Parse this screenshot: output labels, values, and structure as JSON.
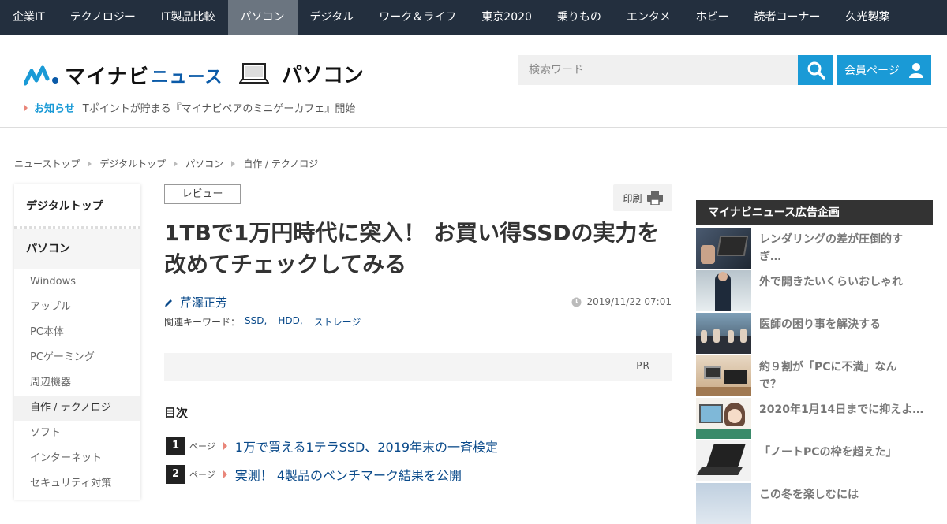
{
  "nav": {
    "items": [
      "企業IT",
      "テクノロジー",
      "IT製品比較",
      "パソコン",
      "デジタル",
      "ワーク＆ライフ",
      "東京2020",
      "乗りもの",
      "エンタメ",
      "ホビー",
      "読者コーナー",
      "久光製薬"
    ],
    "active_index": 3
  },
  "header": {
    "logo_main": "マイナビ",
    "logo_sub": "ニュース",
    "section_title": "パソコン",
    "search_placeholder": "検索ワード",
    "member_label": "会員ページ",
    "notice_label": "お知らせ",
    "notice_text": "Tポイントが貯まる『マイナビペアのミニゲーカフェ』開始"
  },
  "breadcrumb": [
    "ニューストップ",
    "デジタルトップ",
    "パソコン",
    "自作 / テクノロジ"
  ],
  "sidebar": {
    "head": "デジタルトップ",
    "section": "パソコン",
    "items": [
      "Windows",
      "アップル",
      "PC本体",
      "PCゲーミング",
      "周辺機器",
      "自作 / テクノロジ",
      "ソフト",
      "インターネット",
      "セキュリティ対策"
    ],
    "active_index": 5
  },
  "article": {
    "tag": "レビュー",
    "print_label": "印刷",
    "title_line1": "1TBで1万円時代に突入！ お買い得SSDの実力を",
    "title_line2": "改めてチェックしてみる",
    "author": "芹澤正芳",
    "date": "2019/11/22 07:01",
    "keywords_label": "関連キーワード：",
    "keywords": [
      "SSD,",
      "HDD,",
      "ストレージ"
    ],
    "pr_label": "- PR -",
    "toc_head": "目次",
    "toc": [
      {
        "num": "1",
        "page_label": "ページ",
        "text": "1万で買える1テラSSD、2019年末の一斉検定"
      },
      {
        "num": "2",
        "page_label": "ページ",
        "text": "実測！ 4製品のベンチマーク結果を公開"
      }
    ]
  },
  "ads": {
    "head": "マイナビニュース広告企画",
    "items": [
      {
        "line1": "レンダリングの差が圧倒的す",
        "line2": "ぎ…"
      },
      {
        "line1": "外で開きたいくらいおしゃれ",
        "line2": ""
      },
      {
        "line1": "医師の困り事を解決する",
        "line2": ""
      },
      {
        "line1": "約９割が「PCに不満」なん",
        "line2": "で？"
      },
      {
        "line1": "2020年1月14日までに抑えよ…",
        "line2": ""
      },
      {
        "line1": "「ノートPCの枠を超えた」",
        "line2": ""
      },
      {
        "line1": "この冬を楽しむには",
        "line2": ""
      }
    ]
  },
  "colors": {
    "nav_bg": "#232f3e",
    "accent": "#1a9ad6",
    "link": "#0a4a8a",
    "brand_blue": "#0a5aa8",
    "arrow": "#e9867a"
  }
}
